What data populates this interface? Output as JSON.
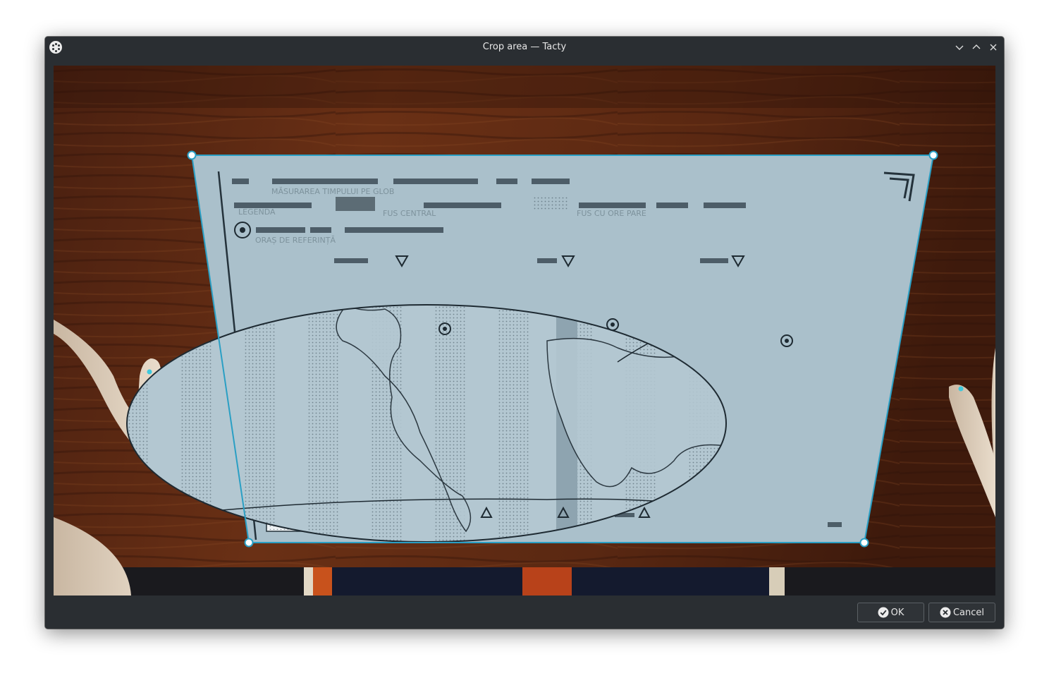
{
  "window": {
    "title": "Crop area — Tacty"
  },
  "titlebar": {
    "app_icon": "tacty-app-icon",
    "minimize_icon": "chevron-down-icon",
    "maximize_icon": "chevron-up-icon",
    "close_icon": "close-icon"
  },
  "document": {
    "heading": "MĂSURAREA TIMPULUI PE GLOB",
    "legend_label": "LEGENDA",
    "fus_central": "FUS CENTRAL",
    "fus_ore_pare": "FUS CU ORE PARE",
    "oras_referinta": "ORAȘ DE REFERINȚĂ"
  },
  "footer": {
    "ok_label": "OK",
    "cancel_label": "Cancel",
    "ok_icon": "checkmark-circle-icon",
    "cancel_icon": "x-circle-icon"
  }
}
